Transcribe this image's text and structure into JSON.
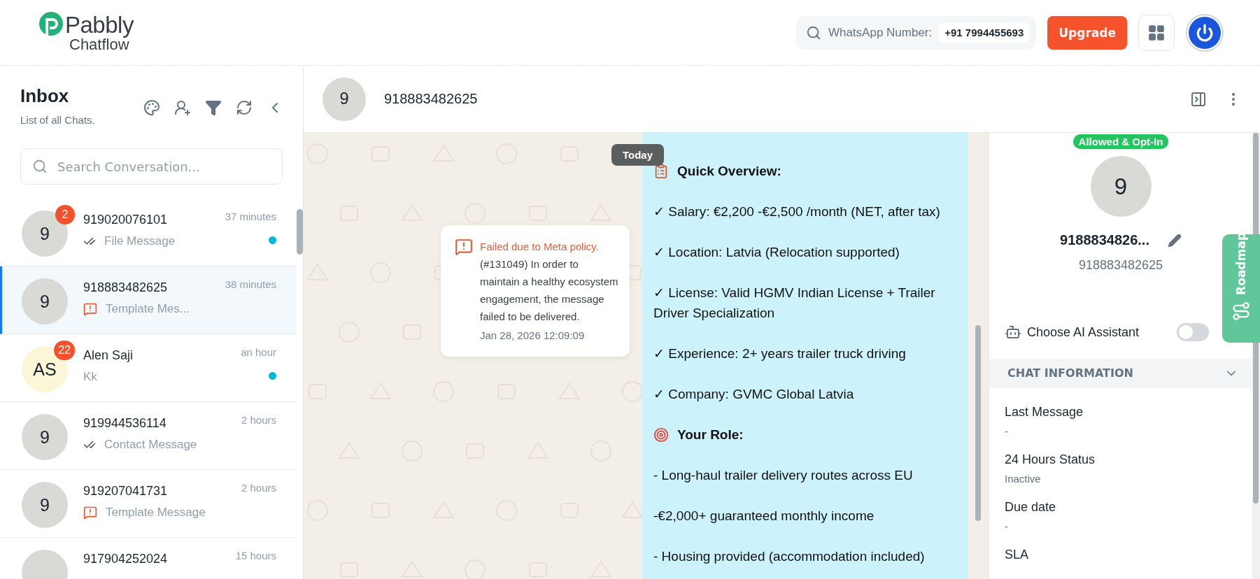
{
  "header": {
    "brand": "Pabbly",
    "product": "Chatflow",
    "whatsapp_label": "WhatsApp Number:",
    "whatsapp_number": "+91 7994455693",
    "upgrade": "Upgrade"
  },
  "inbox": {
    "title": "Inbox",
    "subtitle": "List of all Chats.",
    "search": {
      "placeholder": "Search Conversation..."
    },
    "chats": [
      {
        "avatar": "9",
        "color": "#d9dad6",
        "badge": "2",
        "name": "919020076101",
        "time": "37 minutes",
        "preview": "File Message",
        "kind": "read",
        "unread": true,
        "selected": false
      },
      {
        "avatar": "9",
        "color": "#d9dad6",
        "name": "918883482625",
        "time": "38 minutes",
        "preview": "Template Mes...",
        "kind": "failed",
        "unread": false,
        "selected": true
      },
      {
        "avatar": "AS",
        "color": "#faf6d6",
        "badge": "22",
        "name": "Alen Saji",
        "time": "an hour",
        "preview": "Kk",
        "kind": "plain",
        "unread": true,
        "selected": false
      },
      {
        "avatar": "9",
        "color": "#d9dad6",
        "name": "919944536114",
        "time": "2 hours",
        "preview": "Contact Message",
        "kind": "read",
        "unread": false,
        "selected": false
      },
      {
        "avatar": "9",
        "color": "#d9dad6",
        "name": "919207041731",
        "time": "2 hours",
        "preview": "Template Message",
        "kind": "failed",
        "unread": false,
        "selected": false
      },
      {
        "color": "#d9dad6",
        "name": "917904252024",
        "time": "15 hours",
        "unread": false,
        "selected": false
      }
    ]
  },
  "chat": {
    "avatar": "9",
    "name": "918883482625",
    "date_chip": "Today",
    "failed_card": {
      "title": "Failed due to Meta policy.",
      "body": "(#131049) In order to maintain a healthy ecosystem engagement, the message failed to be delivered.",
      "time": "Jan 28, 2026 12:09:09"
    },
    "message_lines": [
      {
        "kind": "heading",
        "text": "Quick Overview:"
      },
      {
        "kind": "text",
        "text": "✓ Salary: €2,200 -€2,500 /month (NET, after tax)"
      },
      {
        "kind": "text",
        "text": "✓ Location: Latvia (Relocation supported)"
      },
      {
        "kind": "text",
        "text": "✓ License: Valid HGMV Indian License + Trailer Driver Specialization"
      },
      {
        "kind": "text",
        "text": "✓ Experience: 2+ years trailer truck driving"
      },
      {
        "kind": "text",
        "text": "✓ Company: GVMC Global Latvia"
      },
      {
        "kind": "heading",
        "text": "Your Role:"
      },
      {
        "kind": "text",
        "text": "- Long-haul trailer delivery routes across EU"
      },
      {
        "kind": "text",
        "text": "-€2,000+ guaranteed monthly income"
      },
      {
        "kind": "text",
        "text": "- Housing provided (accommodation included)"
      }
    ]
  },
  "contact": {
    "status": "Allowed & Opt-In",
    "avatar": "9",
    "name": "9188834826...",
    "number": "918883482625",
    "ai_assistant": {
      "label": "Choose AI Assistant",
      "on": false
    },
    "section": {
      "title": "CHAT INFORMATION",
      "expanded": true
    },
    "fields": [
      {
        "label": "Last Message",
        "value": "-"
      },
      {
        "label": "24 Hours Status",
        "value": "Inactive"
      },
      {
        "label": "Due date",
        "value": "-"
      },
      {
        "label": "SLA"
      }
    ]
  },
  "roadmap": "Roadmap"
}
